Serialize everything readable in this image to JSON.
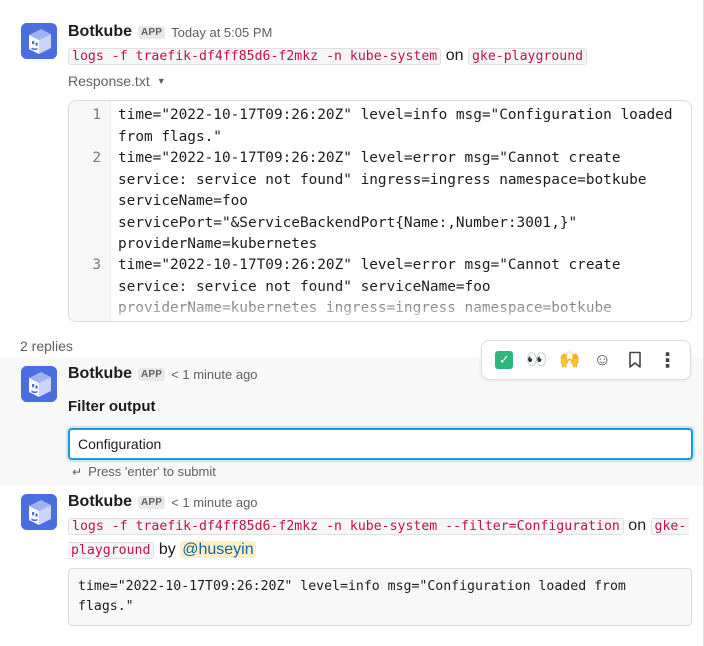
{
  "message1": {
    "author": "Botkube",
    "badge": "APP",
    "time": "Today at 5:05 PM",
    "command": "logs -f traefik-df4ff85d6-f2mkz -n kube-system",
    "on_label": "on",
    "cluster": "gke-playground",
    "file_name": "Response.txt",
    "code_lines": [
      {
        "num": "1",
        "text": "time=\"2022-10-17T09:26:20Z\" level=info msg=\"Configuration loaded from flags.\""
      },
      {
        "num": "2",
        "text": "time=\"2022-10-17T09:26:20Z\" level=error msg=\"Cannot create service: service not found\" ingress=ingress namespace=botkube serviceName=foo servicePort=\"&ServiceBackendPort{Name:,Number:3001,}\" providerName=kubernetes"
      },
      {
        "num": "3",
        "text": "time=\"2022-10-17T09:26:20Z\" level=error msg=\"Cannot create service: service not found\" serviceName=foo providerName=kubernetes ingress=ingress namespace=botkube"
      }
    ]
  },
  "replies_label": "2 replies",
  "toolbar": {
    "check_glyph": "✓",
    "eyes": "👀",
    "hands": "🙌",
    "add_reaction_glyph": "☺",
    "bookmark_glyph": "🔖",
    "more_glyph": "⋮"
  },
  "message2": {
    "author": "Botkube",
    "badge": "APP",
    "time": "< 1 minute ago",
    "filter_label": "Filter output",
    "filter_value": "Configuration",
    "hint_glyph": "↵",
    "hint": "Press 'enter' to submit"
  },
  "message3": {
    "author": "Botkube",
    "badge": "APP",
    "time": "< 1 minute ago",
    "command": "logs -f traefik-df4ff85d6-f2mkz -n kube-system --filter=Configuration",
    "on_label": "on",
    "cluster_part1": "gke-",
    "cluster_part2": "playground",
    "by_label": "by",
    "mention": "@huseyin",
    "output": "time=\"2022-10-17T09:26:20Z\" level=info msg=\"Configuration loaded from flags.\""
  },
  "colors": {
    "avatar": "#4a6ee0",
    "code_red": "#c01343",
    "focus_blue": "#1d9bd1",
    "check_green": "#2eb67d"
  },
  "icons": {
    "avatar": "botkube-cube-icon",
    "dropdown": "caret-down-icon",
    "enter": "enter-return-icon"
  }
}
